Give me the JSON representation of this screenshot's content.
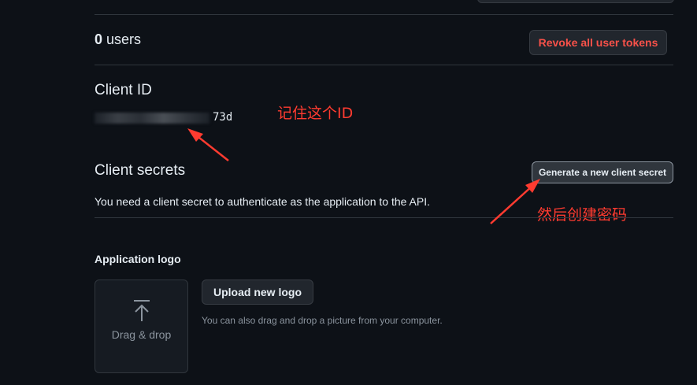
{
  "users": {
    "count": "0",
    "label": "users",
    "revoke_button": "Revoke all user tokens"
  },
  "client_id": {
    "heading": "Client ID",
    "value_suffix": "73d"
  },
  "client_secrets": {
    "heading": "Client secrets",
    "description": "You need a client secret to authenticate as the application to the API.",
    "generate_button": "Generate a new client secret"
  },
  "application_logo": {
    "heading": "Application logo",
    "dropzone_label": "Drag & drop",
    "upload_button": "Upload new logo",
    "hint": "You can also drag and drop a picture from your computer."
  },
  "annotations": {
    "remember_id": "记住这个ID",
    "then_create_secret": "然后创建密码"
  },
  "colors": {
    "background": "#0d1117",
    "danger": "#f85149",
    "annotation": "#ff3b30",
    "border": "#30363d"
  }
}
